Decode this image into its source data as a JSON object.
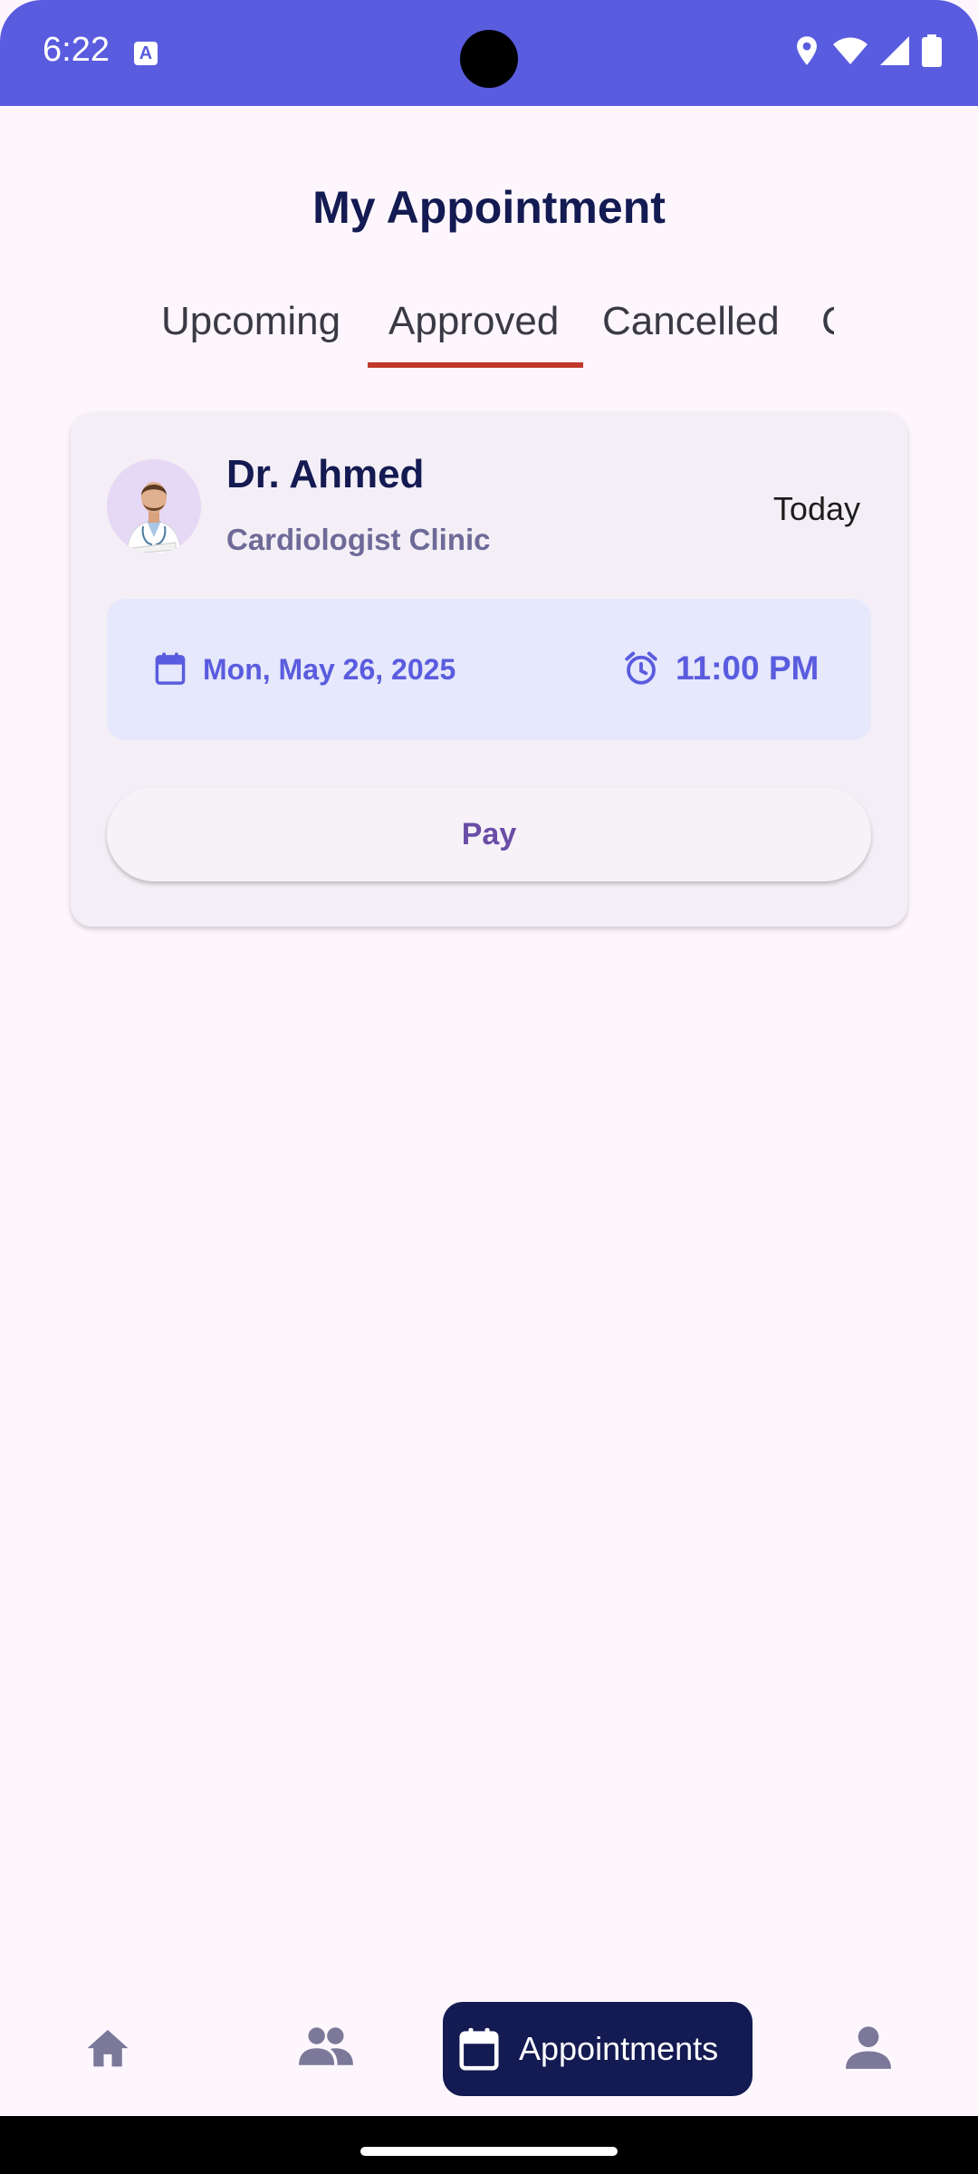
{
  "status_bar": {
    "time": "6:22",
    "notification_icon": "A",
    "icons": [
      "location-icon",
      "wifi-icon",
      "signal-icon",
      "battery-icon"
    ]
  },
  "page": {
    "title": "My Appointment"
  },
  "tabs": [
    {
      "label": "Upcoming",
      "selected": false
    },
    {
      "label": "Approved",
      "selected": true
    },
    {
      "label": "Cancelled",
      "selected": false
    },
    {
      "label": "C",
      "selected": false
    }
  ],
  "appointment": {
    "doctor_name": "Dr. Ahmed",
    "clinic": "Cardiologist Clinic",
    "day": "Today",
    "date": "Mon, May 26, 2025",
    "time": "11:00 PM",
    "action_label": "Pay"
  },
  "bottom_nav": {
    "items": [
      {
        "icon": "home-icon",
        "label": ""
      },
      {
        "icon": "people-icon",
        "label": ""
      },
      {
        "icon": "calendar-icon",
        "label": "Appointments",
        "active": true
      },
      {
        "icon": "person-icon",
        "label": ""
      }
    ]
  },
  "colors": {
    "primary": "#5a5cdf",
    "navy": "#141a52",
    "tab_indicator": "#c0392b",
    "background": "#fdf7fd"
  }
}
